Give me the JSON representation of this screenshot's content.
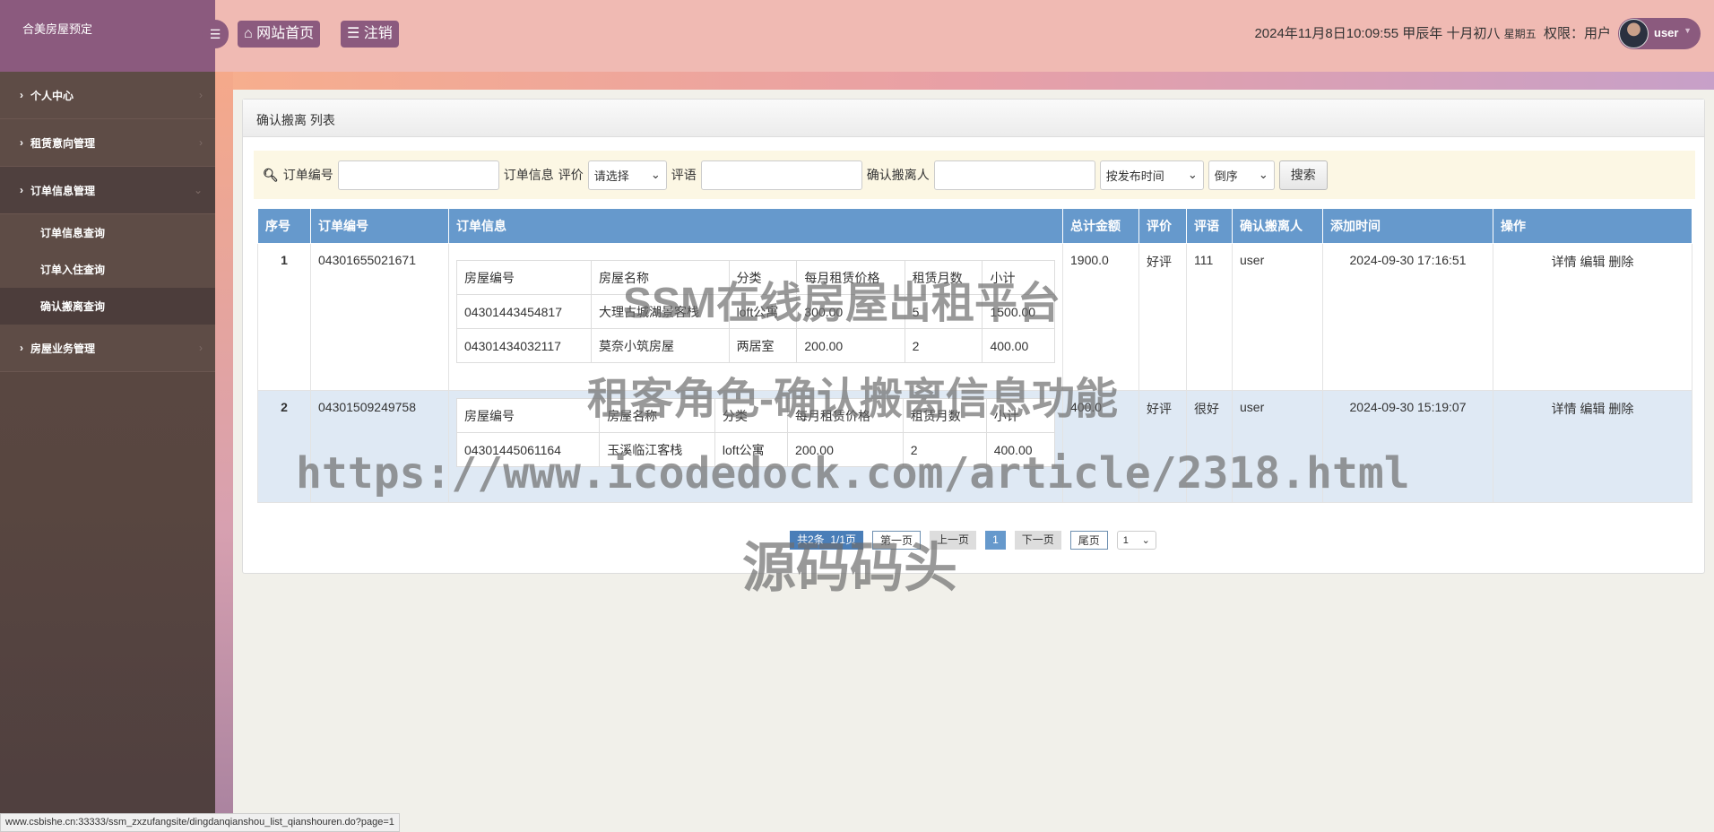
{
  "app": {
    "brand": "合美房屋预定"
  },
  "sidebar": {
    "items": [
      {
        "label": "个人中心"
      },
      {
        "label": "租赁意向管理"
      },
      {
        "label": "订单信息管理",
        "children": [
          {
            "label": "订单信息查询"
          },
          {
            "label": "订单入住查询"
          },
          {
            "label": "确认搬离查询"
          }
        ]
      },
      {
        "label": "房屋业务管理"
      }
    ]
  },
  "header": {
    "home": "网站首页",
    "logout": "注销",
    "datetime": "2024年11月8日10:09:55 甲辰年 十月初八",
    "weekday": "星期五",
    "role": "权限：用户",
    "user": "user"
  },
  "panel": {
    "title": "确认搬离 列表"
  },
  "search": {
    "order_no_label": "订单编号",
    "order_info_label": "订单信息",
    "rating_label": "评价",
    "rating_value": "请选择",
    "comment_label": "评语",
    "person_label": "确认搬离人",
    "sort_field": "按发布时间",
    "sort_order": "倒序",
    "search_btn": "搜索"
  },
  "table": {
    "headers": [
      "序号",
      "订单编号",
      "订单信息",
      "总计金额",
      "评价",
      "评语",
      "确认搬离人",
      "添加时间",
      "操作"
    ],
    "inner_headers": [
      "房屋编号",
      "房屋名称",
      "分类",
      "每月租赁价格",
      "租赁月数",
      "小计"
    ],
    "actions": [
      "详情",
      "编辑",
      "删除"
    ],
    "rows": [
      {
        "idx": "1",
        "order_no": "04301655021671",
        "items": [
          [
            "04301443454817",
            "大理古城湖景客栈",
            "loft公寓",
            "300.00",
            "5",
            "1500.00"
          ],
          [
            "04301434032117",
            "莫奈小筑房屋",
            "两居室",
            "200.00",
            "2",
            "400.00"
          ]
        ],
        "total": "1900.0",
        "rating": "好评",
        "comment": "111",
        "person": "user",
        "time": "2024-09-30 17:16:51"
      },
      {
        "idx": "2",
        "order_no": "04301509249758",
        "items": [
          [
            "04301445061164",
            "玉溪临江客栈",
            "loft公寓",
            "200.00",
            "2",
            "400.00"
          ]
        ],
        "total": "400.0",
        "rating": "好评",
        "comment": "很好",
        "person": "user",
        "time": "2024-09-30 15:19:07"
      }
    ]
  },
  "pager": {
    "info": "共2条  1/1页",
    "first": "第一页",
    "prev": "上一页",
    "current": "1",
    "next": "下一页",
    "last": "尾页",
    "select": "1"
  },
  "watermark": {
    "line1": "SSM在线房屋出租平台",
    "line2": "租客角色-确认搬离信息功能",
    "line3": "https://www.icodedock.com/article/2318.html",
    "line4": "源码码头"
  },
  "status_url": "www.csbishe.cn:33333/ssm_zxzufangsite/dingdanqianshou_list_qianshouren.do?page=1"
}
